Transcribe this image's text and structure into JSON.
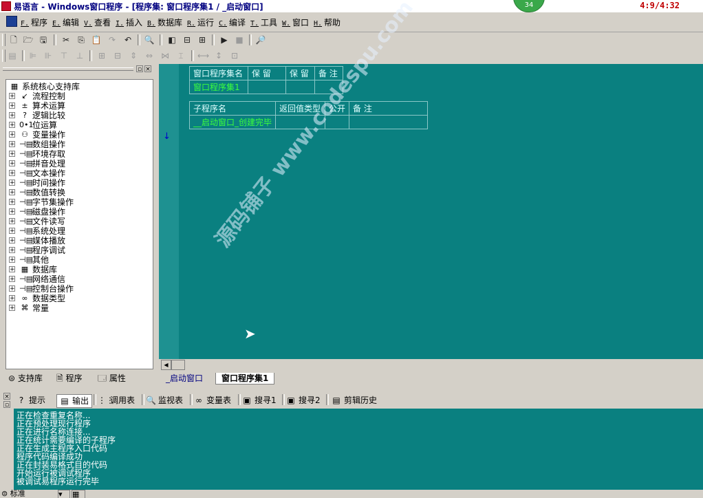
{
  "titlebar": {
    "title": "易语言 - Windows窗口程序 - [程序集: 窗口程序集1 / _启动窗口]",
    "badge": "34",
    "clock": "4:9/4:32"
  },
  "menu": {
    "items": [
      {
        "acc": "F.",
        "label": "程序"
      },
      {
        "acc": "E.",
        "label": "编辑"
      },
      {
        "acc": "V.",
        "label": "查看"
      },
      {
        "acc": "I.",
        "label": "插入"
      },
      {
        "acc": "B.",
        "label": "数据库"
      },
      {
        "acc": "R.",
        "label": "运行"
      },
      {
        "acc": "C.",
        "label": "编译"
      },
      {
        "acc": "T.",
        "label": "工具"
      },
      {
        "acc": "W.",
        "label": "窗口"
      },
      {
        "acc": "H.",
        "label": "帮助"
      }
    ]
  },
  "tree": {
    "root": "系统核心支持库",
    "items": [
      {
        "icon": "↙",
        "label": "流程控制"
      },
      {
        "icon": "±",
        "label": "算术运算"
      },
      {
        "icon": "?",
        "label": "逻辑比较"
      },
      {
        "icon": "0•1",
        "label": "位运算"
      },
      {
        "icon": "⚇",
        "label": "变量操作"
      },
      {
        "icon": "⊣▤",
        "label": "数组操作"
      },
      {
        "icon": "⊣▤",
        "label": "环境存取"
      },
      {
        "icon": "⊣▤",
        "label": "拼音处理"
      },
      {
        "icon": "⊣▤",
        "label": "文本操作"
      },
      {
        "icon": "⊣▤",
        "label": "时间操作"
      },
      {
        "icon": "⊣▤",
        "label": "数值转换"
      },
      {
        "icon": "⊣▤",
        "label": "字节集操作"
      },
      {
        "icon": "⊣▤",
        "label": "磁盘操作"
      },
      {
        "icon": "⊣▤",
        "label": "文件读写"
      },
      {
        "icon": "⊣▤",
        "label": "系统处理"
      },
      {
        "icon": "⊣▤",
        "label": "媒体播放"
      },
      {
        "icon": "⊣▤",
        "label": "程序调试"
      },
      {
        "icon": "⊣▤",
        "label": "其他"
      },
      {
        "icon": "▦",
        "label": "数据库"
      },
      {
        "icon": "⊣▤",
        "label": "网络通信"
      },
      {
        "icon": "⊣▤",
        "label": "控制台操作"
      },
      {
        "icon": "∞",
        "label": "数据类型"
      },
      {
        "icon": "⌘",
        "label": "常量"
      }
    ]
  },
  "left_tabs": [
    "支持库",
    "程序",
    "属性"
  ],
  "assembly_table": {
    "headers": [
      "窗口程序集名",
      "保 留",
      "保 留",
      "备 注"
    ],
    "row": [
      "窗口程序集1",
      "",
      "",
      ""
    ]
  },
  "sub_table": {
    "headers": [
      "子程序名",
      "返回值类型",
      "公开",
      "备 注"
    ],
    "row": [
      "__启动窗口_创建完毕",
      "",
      "",
      ""
    ]
  },
  "code_tabs": [
    "_启动窗口",
    "窗口程序集1"
  ],
  "bottom_tabs": [
    {
      "icon": "?",
      "label": "提示"
    },
    {
      "icon": "▤",
      "label": "输出"
    },
    {
      "icon": "⋮⋮",
      "label": "调用表"
    },
    {
      "icon": "🔍",
      "label": "监视表"
    },
    {
      "icon": "∞",
      "label": "变量表"
    },
    {
      "icon": "▣",
      "label": "搜寻1"
    },
    {
      "icon": "▣",
      "label": "搜寻2"
    },
    {
      "icon": "▤",
      "label": "剪辑历史"
    }
  ],
  "output_lines": [
    "正在检查重复名称...",
    "正在预处理现行程序",
    "正在进行名称连接...",
    "正在统计需要编译的子程序",
    "正在生成主程序入口代码",
    "程序代码编译成功",
    "正在封装易格式目的代码",
    "开始运行被调试程序",
    "被调试易程序运行完毕"
  ],
  "statusbar": {
    "mode": "标准"
  },
  "watermark": "源码铺子 www.codespu.com"
}
